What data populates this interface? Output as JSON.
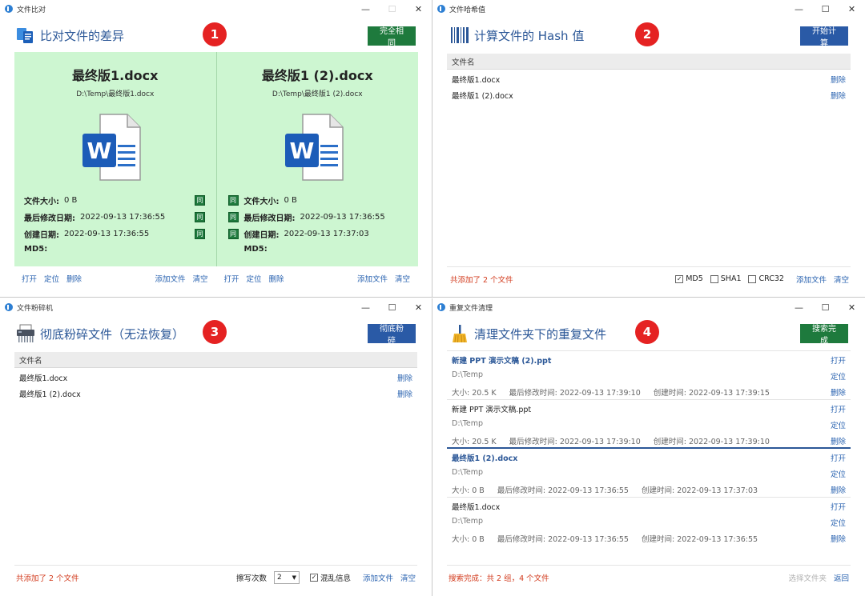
{
  "windows": {
    "compare": {
      "title": "文件比对",
      "heading": "比对文件的差异",
      "badge": "1",
      "action_button": "完全相同",
      "left": {
        "name": "最终版1.docx",
        "path": "D:\\Temp\\最终版1.docx",
        "size_label": "文件大小:",
        "size": "0 B",
        "modified_label": "最后修改日期:",
        "modified": "2022-09-13  17:36:55",
        "created_label": "创建日期:",
        "created": "2022-09-13  17:36:55",
        "md5_label": "MD5:"
      },
      "right": {
        "name": "最终版1 (2).docx",
        "path": "D:\\Temp\\最终版1 (2).docx",
        "size_label": "文件大小:",
        "size": "0 B",
        "modified_label": "最后修改日期:",
        "modified": "2022-09-13  17:36:55",
        "created_label": "创建日期:",
        "created": "2022-09-13  17:37:03",
        "md5_label": "MD5:"
      },
      "same_tag": "同",
      "footer_left": [
        "打开",
        "定位",
        "删除"
      ],
      "footer_mid": [
        "添加文件",
        "清空"
      ],
      "footer_right_a": [
        "打开",
        "定位",
        "删除"
      ],
      "footer_right_b": [
        "添加文件",
        "清空"
      ]
    },
    "hash": {
      "title": "文件哈希值",
      "heading": "计算文件的 Hash 值",
      "badge": "2",
      "action_button": "开始计算",
      "column_header": "文件名",
      "rows": [
        {
          "name": "最终版1.docx",
          "action": "删除"
        },
        {
          "name": "最终版1 (2).docx",
          "action": "删除"
        }
      ],
      "status": "共添加了 2 个文件",
      "options": [
        {
          "label": "MD5",
          "checked": true
        },
        {
          "label": "SHA1",
          "checked": false
        },
        {
          "label": "CRC32",
          "checked": false
        }
      ],
      "footer_links": [
        "添加文件",
        "清空"
      ]
    },
    "shred": {
      "title": "文件粉碎机",
      "heading": "彻底粉碎文件（无法恢复）",
      "badge": "3",
      "action_button": "彻底粉碎",
      "column_header": "文件名",
      "rows": [
        {
          "name": "最终版1.docx",
          "action": "删除"
        },
        {
          "name": "最终版1 (2).docx",
          "action": "删除"
        }
      ],
      "status": "共添加了 2 个文件",
      "overwrite_label": "擦写次数",
      "overwrite_value": "2",
      "scramble_label": "混乱信息",
      "scramble_checked": true,
      "footer_links": [
        "添加文件",
        "清空"
      ]
    },
    "dedupe": {
      "title": "重复文件清理",
      "heading": "清理文件夹下的重复文件",
      "badge": "4",
      "action_button": "搜索完成",
      "size_prefix": "大小:",
      "modified_prefix": "最后修改时间:",
      "created_prefix": "创建时间:",
      "actions": [
        "打开",
        "定位",
        "删除"
      ],
      "items": [
        {
          "name": "新建 PPT 演示文稿 (2).ppt",
          "path": "D:\\Temp",
          "size": "20.5 K",
          "modified": "2022-09-13  17:39:10",
          "created": "2022-09-13  17:39:15",
          "highlight": true
        },
        {
          "name": "新建 PPT 演示文稿.ppt",
          "path": "D:\\Temp",
          "size": "20.5 K",
          "modified": "2022-09-13  17:39:10",
          "created": "2022-09-13  17:39:10",
          "highlight": false
        },
        {
          "name": "最终版1 (2).docx",
          "path": "D:\\Temp",
          "size": "0 B",
          "modified": "2022-09-13  17:36:55",
          "created": "2022-09-13  17:37:03",
          "highlight": true
        },
        {
          "name": "最终版1.docx",
          "path": "D:\\Temp",
          "size": "0 B",
          "modified": "2022-09-13  17:36:55",
          "created": "2022-09-13  17:36:55",
          "highlight": false
        }
      ],
      "status": "搜索完成：共 2 组，4 个文件",
      "select_folder": "选择文件夹",
      "back": "返回"
    }
  },
  "colors": {
    "accent_blue": "#2b5797",
    "green_button": "#1e7a3d",
    "blue_button": "#2a5aa6",
    "compare_bg": "#cdf6d1",
    "badge_red": "#e52222",
    "status_red": "#d23a1c",
    "link_blue": "#2a63b0"
  }
}
